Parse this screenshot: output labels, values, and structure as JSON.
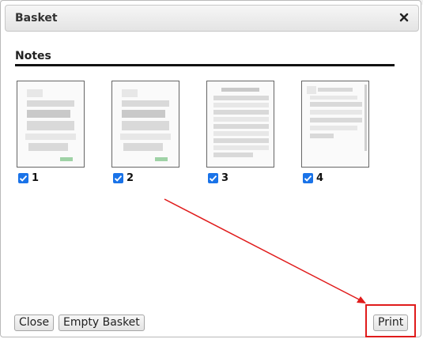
{
  "dialog": {
    "title": "Basket",
    "close_icon": "close-icon"
  },
  "section": {
    "title": "Notes"
  },
  "items": [
    {
      "label": "1",
      "checked": true
    },
    {
      "label": "2",
      "checked": true
    },
    {
      "label": "3",
      "checked": true
    },
    {
      "label": "4",
      "checked": true
    }
  ],
  "footer": {
    "close_label": "Close",
    "empty_label": "Empty Basket",
    "print_label": "Print"
  },
  "colors": {
    "checkbox": "#1a73e8",
    "annotation": "#e01b1b"
  }
}
